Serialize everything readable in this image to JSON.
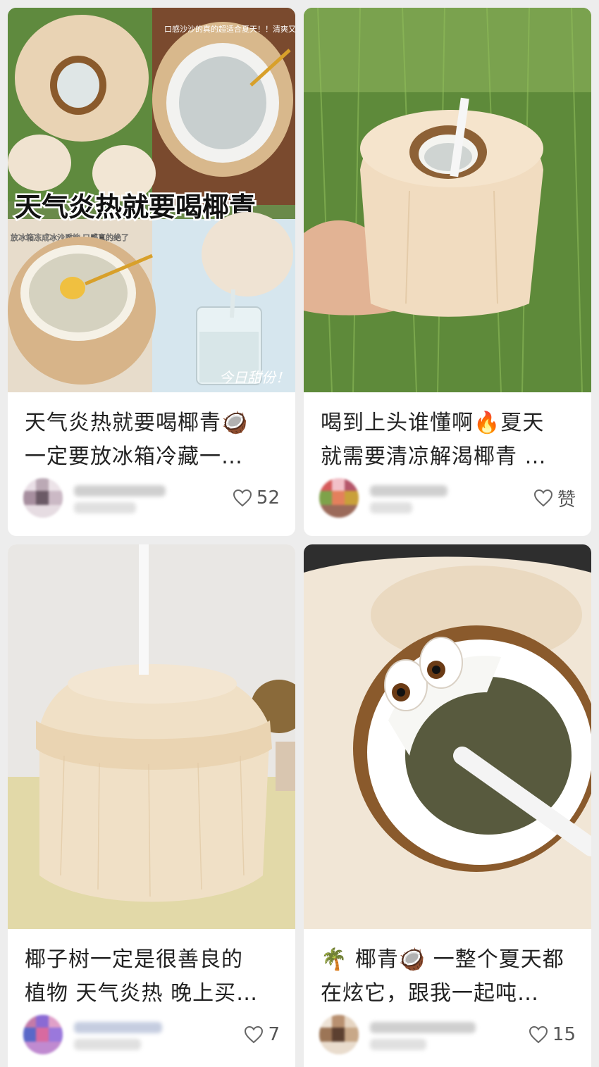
{
  "feed": {
    "posts": [
      {
        "image_icon": "coconut-collage-image",
        "overlay_top": "口感沙沙的真的超适合夏天！！清爽又解腻",
        "overlay_headline": "天气炎热就要喝椰青",
        "overlay_small": "放冰箱冻成冰沙质地 口感真的绝了",
        "overlay_stamp": "今日甜份！",
        "title_line1": "天气炎热就要喝椰青🥥",
        "title_line2": "一定要放冰箱冷藏一…",
        "like_icon": "heart-icon",
        "likes": "52"
      },
      {
        "image_icon": "coconut-on-grass-image",
        "title_line1": "喝到上头谁懂啊🔥夏天",
        "title_line2": "就需要清凉解渴椰青 …",
        "like_icon": "heart-icon",
        "likes": "赞"
      },
      {
        "image_icon": "coconut-with-straw-image",
        "title_line1": "椰子树一定是很善良的",
        "title_line2": "植物 天气炎热 晚上买…",
        "like_icon": "heart-icon",
        "likes": "7"
      },
      {
        "image_icon": "opened-coconut-eyes-image",
        "title_line1": "🌴 椰青🥥 一整个夏天都",
        "title_line2": "在炫它，跟我一起吨…",
        "like_icon": "heart-icon",
        "likes": "15"
      }
    ]
  },
  "colors": {
    "background": "#ededed",
    "card": "#ffffff",
    "text": "#222222",
    "muted": "#555555"
  }
}
